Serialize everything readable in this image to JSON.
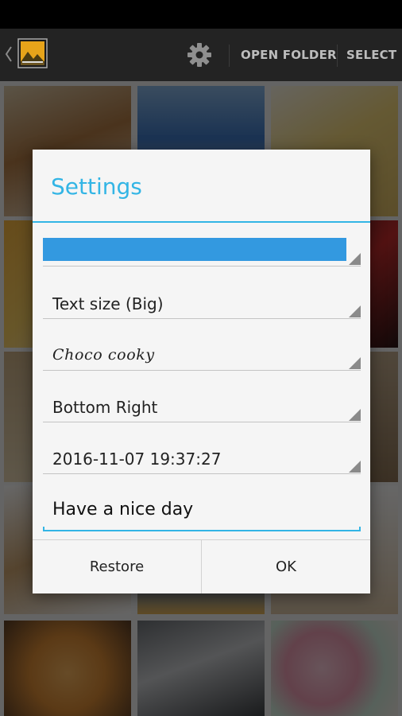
{
  "action_bar": {
    "open_folder_label": "OPEN FOLDER",
    "select_label": "SELECT",
    "icons": [
      "back-chevron-icon",
      "app-photo-icon",
      "gear-icon"
    ]
  },
  "dialog": {
    "title": "Settings",
    "color_setting_value": "#3399e0",
    "text_size": "Text size (Big)",
    "font": "Choco cooky",
    "position": "Bottom Right",
    "timestamp": "2016-11-07 19:37:27",
    "message": "Have a nice day",
    "restore_label": "Restore",
    "ok_label": "OK"
  },
  "colors": {
    "accent": "#33b5e5",
    "action_bar": "#232323",
    "status_bar": "#000000",
    "color_swatch": "#3399e0"
  }
}
